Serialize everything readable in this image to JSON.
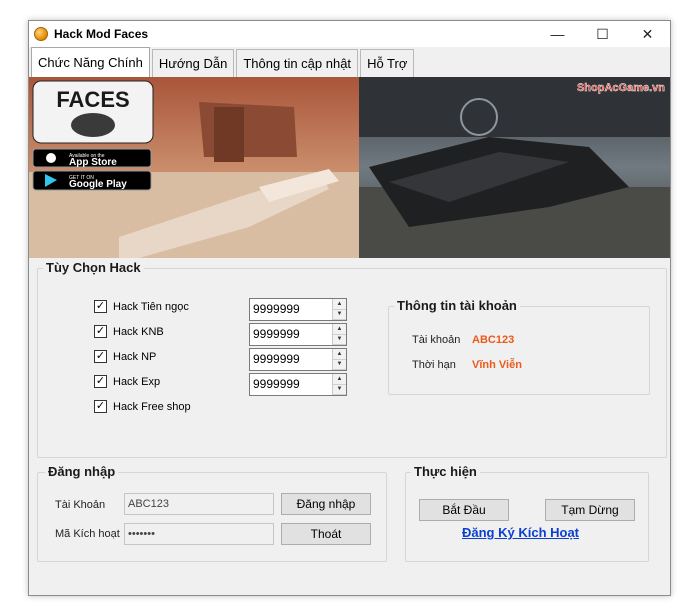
{
  "window": {
    "title": "Hack Mod Faces"
  },
  "window_buttons": {
    "minimize": "—",
    "maximize": "☐",
    "close": "✕"
  },
  "tabs": [
    {
      "label": "Chức Năng Chính"
    },
    {
      "label": "Hướng Dẫn"
    },
    {
      "label": "Thông tin cập nhật"
    },
    {
      "label": "Hỗ Trợ"
    }
  ],
  "banner": {
    "logo_text": "FACES",
    "app_store": {
      "small": "Available on the",
      "big": "App Store"
    },
    "google_play": {
      "small": "GET IT ON",
      "big": "Google Play"
    },
    "watermark": "ShopAcGame.vn"
  },
  "hack_options": {
    "title": "Tùy Chọn Hack",
    "items": [
      {
        "label": "Hack Tiên ngọc",
        "checked": true,
        "value": "9999999"
      },
      {
        "label": "Hack KNB",
        "checked": true,
        "value": "9999999"
      },
      {
        "label": "Hack NP",
        "checked": true,
        "value": "9999999"
      },
      {
        "label": "Hack Exp",
        "checked": true,
        "value": "9999999"
      },
      {
        "label": "Hack Free shop",
        "checked": true
      }
    ]
  },
  "account_info": {
    "title": "Thông tin tài khoản",
    "account_label": "Tài khoản",
    "account_value": "ABC123",
    "duration_label": "Thời hạn",
    "duration_value": "Vĩnh Viễn"
  },
  "login": {
    "title": "Đăng nhập",
    "account_label": "Tài Khoản",
    "account_value": "ABC123",
    "code_label": "Mã Kích hoạt",
    "code_value": "•••••••",
    "login_button": "Đăng nhập",
    "exit_button": "Thoát"
  },
  "execute": {
    "title": "Thực hiện",
    "start_button": "Bắt Đầu",
    "pause_button": "Tạm Dừng",
    "register_link": "Đăng Ký Kích Hoạt"
  },
  "colors": {
    "accent_value": "#ea5a1a",
    "link": "#0a3fd0"
  }
}
